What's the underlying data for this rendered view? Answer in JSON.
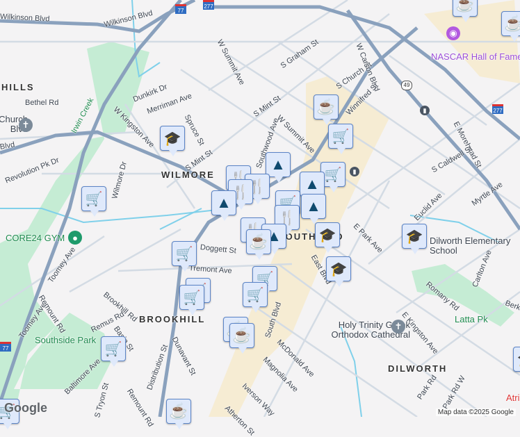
{
  "streets": [
    "Wilkinson Blvd",
    "W Summit Ave",
    "S Graham St",
    "S Church St",
    "W Carson Blvd",
    "Winnifred St",
    "S Mint St",
    "S Mint St",
    "Dunkirk Dr",
    "Merriman Ave",
    "W Kingston Ave",
    "Spruce St",
    "Bethel Rd",
    "Revolution Pk Dr",
    "Wilmore Dr",
    "W Summit Ave",
    "Southwood Ave",
    "E Morehead St",
    "S Caldwell St",
    "Myrtle Ave",
    "E Park Ave",
    "Euclid Ave",
    "Romany Rd",
    "Carlton Ave",
    "Berkeley Ave",
    "E Kingston Ave",
    "South Blvd",
    "McDonald Ave",
    "Magnolia Ave",
    "Park Rd",
    "Doggett St",
    "Tremont Ave",
    "Toomey Ave",
    "Toomey Ave",
    "Remount Rd",
    "Remount Rd",
    "Brookhill Rd",
    "Remus Rd",
    "Basin St",
    "Dunavant St",
    "Distribution St",
    "S Tryon St",
    "Baltimore Ave",
    "Iverson Way",
    "Atherton St",
    "Park Rd W",
    "Blvd",
    "East Blvd"
  ],
  "areas": [
    "HILLS",
    "WILMORE",
    "BROOKHILL",
    "DILWORTH",
    "SOUTH END"
  ],
  "parks": [
    "Irwin Creek",
    "Southside Park",
    "Latta Pk"
  ],
  "pois": {
    "nascar": "NASCAR Hall of Fame",
    "gym": "CORE24 GYM",
    "dilworth_school": "Dilworth Elementary School",
    "holy_trinity": "Holy Trinity Greek Orthodox Cathedral",
    "church": "Church Blvd",
    "atrium": "Atrium"
  },
  "shields": {
    "i77": "77",
    "i277": "277",
    "i277b": "277",
    "i77b": "77",
    "us49": "49"
  },
  "attribution": "Map data ©2025 Google",
  "logo": "Google",
  "colors": {
    "pin_bg": "#dfe9fb",
    "pin_icon": "#0f4a6e",
    "highway": "#8aa1bd",
    "park": "#c5ecd4"
  }
}
